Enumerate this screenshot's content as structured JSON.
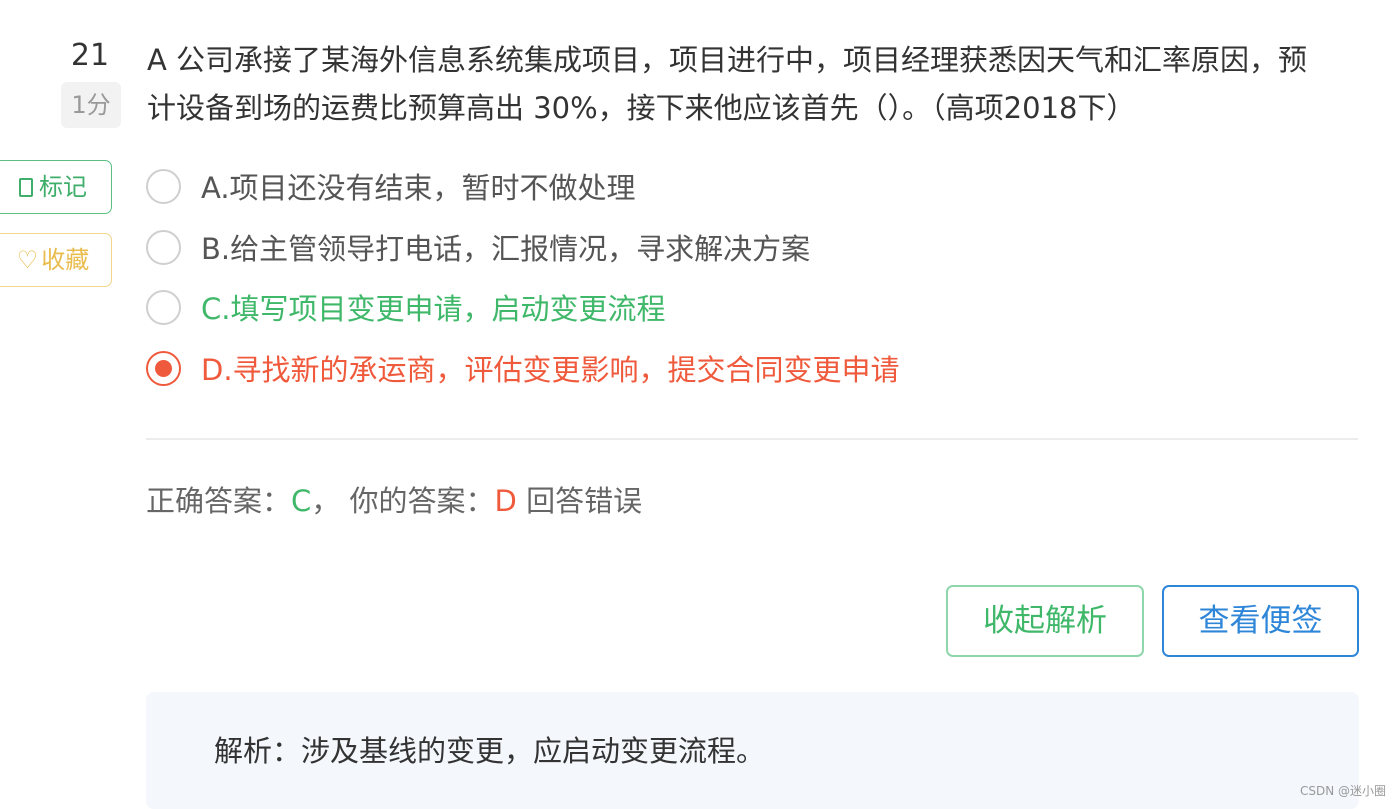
{
  "question": {
    "number": "21",
    "score": "1分",
    "text": "A 公司承接了某海外信息系统集成项目，项目进行中，项目经理获悉因天气和汇率原因，预计设备到场的运费比预算高出 30%，接下来他应该首先（）。（高项2018下）"
  },
  "side_buttons": {
    "mark_label": "标记",
    "favorite_label": "收藏",
    "favorite_icon": "♡"
  },
  "options": [
    {
      "label": "A.项目还没有结束，暂时不做处理",
      "state": "normal",
      "selected": false
    },
    {
      "label": "B.给主管领导打电话，汇报情况，寻求解决方案",
      "state": "normal",
      "selected": false
    },
    {
      "label": "C.填写项目变更申请，启动变更流程",
      "state": "correct",
      "selected": false
    },
    {
      "label": "D.寻找新的承运商，评估变更影响，提交合同变更申请",
      "state": "wrong",
      "selected": true
    }
  ],
  "result": {
    "correct_label": "正确答案：",
    "correct_value": "C",
    "separator": "，",
    "yours_label": "你的答案：",
    "yours_value": "D",
    "verdict": "回答错误"
  },
  "actions": {
    "collapse_label": "收起解析",
    "memo_label": "查看便签"
  },
  "analysis": {
    "text": "解析：涉及基线的变更，应启动变更流程。"
  },
  "watermark": "CSDN @迷小圈",
  "colors": {
    "correct": "#3fb86a",
    "wrong": "#f05a3c",
    "primary": "#2e86d8",
    "favorite": "#e9bc4e"
  }
}
